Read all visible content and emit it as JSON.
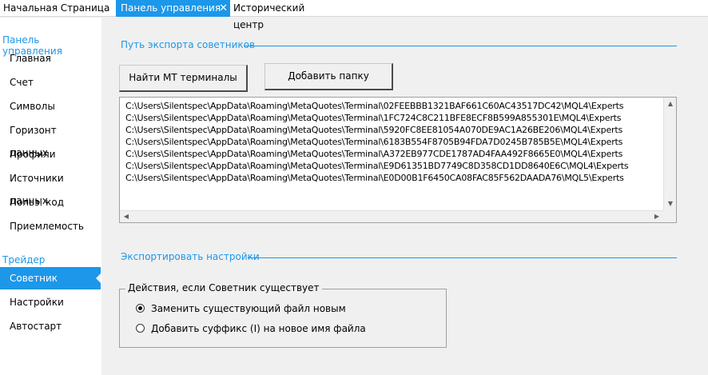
{
  "tabs": [
    {
      "label": "Начальная Страница"
    },
    {
      "label": "Панель управления",
      "close": "✕"
    },
    {
      "label": "Исторический центр"
    }
  ],
  "sidebar": {
    "section1": "Панель управления",
    "items1": [
      "Главная",
      "Счет",
      "Символы",
      "Горизонт данных",
      "Профили",
      "Источники данных",
      "Польз. код",
      "Приемлемость"
    ],
    "section2": "Трейдер",
    "items2": [
      "Советник",
      "Настройки",
      "Автостарт"
    ],
    "active": "Советник"
  },
  "export_path": {
    "header": "Путь экспорта советников",
    "find_button": "Найти МТ терминалы",
    "add_button": "Добавить папку",
    "paths": [
      "C:\\Users\\Silentspec\\AppData\\Roaming\\MetaQuotes\\Terminal\\02FEEBBB1321BAF661C60AC43517DC42\\MQL4\\Experts",
      "C:\\Users\\Silentspec\\AppData\\Roaming\\MetaQuotes\\Terminal\\1FC724C8C211BFE8ECF8B599A855301E\\MQL4\\Experts",
      "C:\\Users\\Silentspec\\AppData\\Roaming\\MetaQuotes\\Terminal\\5920FC8EE81054A070DE9AC1A26BE206\\MQL4\\Experts",
      "C:\\Users\\Silentspec\\AppData\\Roaming\\MetaQuotes\\Terminal\\6183B554F8705B94FDA7D0245B785B5E\\MQL4\\Experts",
      "C:\\Users\\Silentspec\\AppData\\Roaming\\MetaQuotes\\Terminal\\A372EB977CDE1787AD4FAA492F8665E0\\MQL4\\Experts",
      "C:\\Users\\Silentspec\\AppData\\Roaming\\MetaQuotes\\Terminal\\E9D61351BD7749C8D358CD1DD8640E6C\\MQL4\\Experts",
      "C:\\Users\\Silentspec\\AppData\\Roaming\\MetaQuotes\\Terminal\\E0D00B1F6450CA08FAC85F562DAADA76\\MQL5\\Experts"
    ]
  },
  "export_settings": {
    "header": "Экспортировать настройки",
    "group_label": "Действия, если Советник существует",
    "options": [
      {
        "label": "Заменить существующий файл новым",
        "checked": true
      },
      {
        "label": "Добавить суффикс (I) на новое имя файла",
        "checked": false
      }
    ]
  },
  "colors": {
    "accent": "#1c97ea"
  }
}
